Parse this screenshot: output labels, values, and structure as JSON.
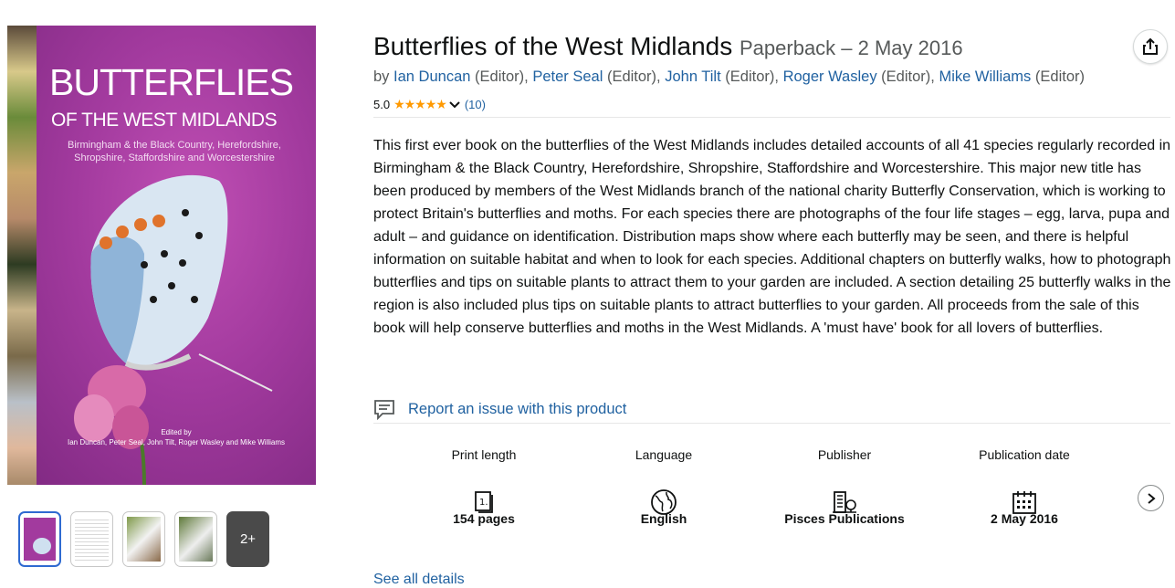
{
  "product": {
    "title": "Butterflies of the West Midlands",
    "format_date": "Paperback – 2 May 2016",
    "by_prefix": "by",
    "authors": [
      {
        "name": "Ian Duncan",
        "role": "(Editor),"
      },
      {
        "name": "Peter Seal",
        "role": "(Editor),"
      },
      {
        "name": "John Tilt",
        "role": "(Editor),"
      },
      {
        "name": "Roger Wasley",
        "role": "(Editor),"
      },
      {
        "name": "Mike Williams",
        "role": "(Editor)"
      }
    ],
    "rating_value": "5.0",
    "rating_count": "(10)",
    "description": "This first ever book on the butterflies of the West Midlands includes detailed accounts of all 41 species regularly recorded in Birmingham & the Black Country, Herefordshire, Shropshire, Staffordshire and Worcestershire. This major new title has been produced by members of the West Midlands branch of the national charity Butterfly Conservation, which is working to protect Britain's butterflies and moths. For each species there are photographs of the four life stages – egg, larva, pupa and adult – and guidance on identification. Distribution maps show where each butterfly may be seen, and there is helpful information on suitable habitat and when to look for each species. Additional chapters on butterfly walks, how to photograph butterflies and tips on suitable plants to attract them to your garden are included. A section detailing 25 butterfly walks in the region is also included plus tips on suitable plants to attract butterflies to your garden. All proceeds from the sale of this book will help conserve butterflies and moths in the West Midlands. A 'must have' book for all lovers of butterflies.",
    "report_issue": "Report an issue with this product",
    "see_all": "See all details"
  },
  "cover": {
    "title_line1": "BUTTERFLIES",
    "title_line2": "OF THE WEST MIDLANDS",
    "subtitle": "Birmingham & the Black Country, Herefordshire, Shropshire, Staffordshire and Worcestershire",
    "edited_by": "Edited by",
    "editors": "Ian Duncan, Peter Seal, John Tilt, Roger Wasley and Mike Williams"
  },
  "thumbnails": {
    "more_label": "2+"
  },
  "attributes": [
    {
      "label": "Print length",
      "value": "154 pages",
      "icon": "book-page-icon"
    },
    {
      "label": "Language",
      "value": "English",
      "icon": "globe-icon"
    },
    {
      "label": "Publisher",
      "value": "Pisces Publications",
      "icon": "building-icon"
    },
    {
      "label": "Publication date",
      "value": "2 May 2016",
      "icon": "calendar-icon"
    }
  ],
  "colors": {
    "link": "#2162a1",
    "star": "#ff9900",
    "cover_bg": "#a23a9e",
    "selected_thumb": "#2f6ad1"
  }
}
